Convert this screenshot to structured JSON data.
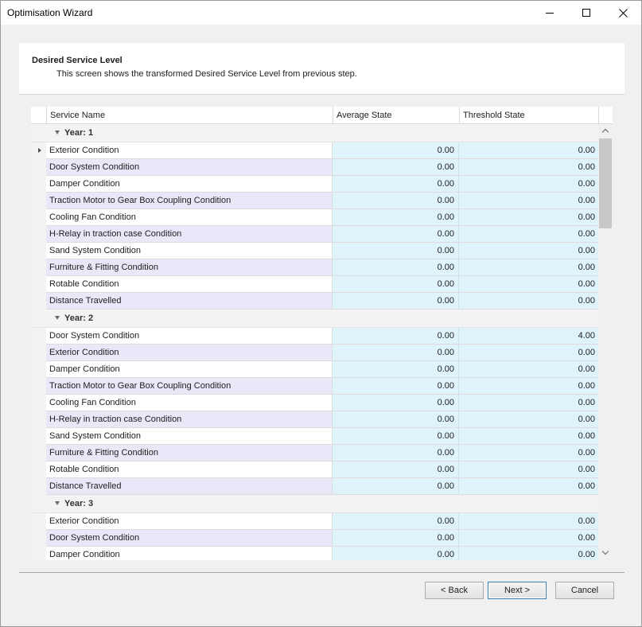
{
  "window": {
    "title": "Optimisation Wizard"
  },
  "header": {
    "title": "Desired Service Level",
    "subtitle": "This screen shows the transformed Desired Service Level from previous step."
  },
  "grid": {
    "columns": {
      "name": "Service Name",
      "average": "Average State",
      "threshold": "Threshold State"
    },
    "groups": [
      {
        "label": "Year: 1",
        "rows": [
          {
            "name": "Exterior Condition",
            "avg": "0.00",
            "thr": "0.00"
          },
          {
            "name": "Door System Condition",
            "avg": "0.00",
            "thr": "0.00"
          },
          {
            "name": "Damper Condition",
            "avg": "0.00",
            "thr": "0.00"
          },
          {
            "name": "Traction Motor to Gear Box Coupling Condition",
            "avg": "0.00",
            "thr": "0.00"
          },
          {
            "name": "Cooling Fan Condition",
            "avg": "0.00",
            "thr": "0.00"
          },
          {
            "name": "H-Relay in traction case Condition",
            "avg": "0.00",
            "thr": "0.00"
          },
          {
            "name": "Sand System Condition",
            "avg": "0.00",
            "thr": "0.00"
          },
          {
            "name": "Furniture & Fitting Condition",
            "avg": "0.00",
            "thr": "0.00"
          },
          {
            "name": "Rotable Condition",
            "avg": "0.00",
            "thr": "0.00"
          },
          {
            "name": "Distance Travelled",
            "avg": "0.00",
            "thr": "0.00"
          }
        ]
      },
      {
        "label": "Year: 2",
        "rows": [
          {
            "name": "Door System Condition",
            "avg": "0.00",
            "thr": "4.00"
          },
          {
            "name": "Exterior Condition",
            "avg": "0.00",
            "thr": "0.00"
          },
          {
            "name": "Damper Condition",
            "avg": "0.00",
            "thr": "0.00"
          },
          {
            "name": "Traction Motor to Gear Box Coupling Condition",
            "avg": "0.00",
            "thr": "0.00"
          },
          {
            "name": "Cooling Fan Condition",
            "avg": "0.00",
            "thr": "0.00"
          },
          {
            "name": "H-Relay in traction case Condition",
            "avg": "0.00",
            "thr": "0.00"
          },
          {
            "name": "Sand System Condition",
            "avg": "0.00",
            "thr": "0.00"
          },
          {
            "name": "Furniture & Fitting Condition",
            "avg": "0.00",
            "thr": "0.00"
          },
          {
            "name": "Rotable Condition",
            "avg": "0.00",
            "thr": "0.00"
          },
          {
            "name": "Distance Travelled",
            "avg": "0.00",
            "thr": "0.00"
          }
        ]
      },
      {
        "label": "Year: 3",
        "rows": [
          {
            "name": "Exterior Condition",
            "avg": "0.00",
            "thr": "0.00"
          },
          {
            "name": "Door System Condition",
            "avg": "0.00",
            "thr": "0.00"
          },
          {
            "name": "Damper Condition",
            "avg": "0.00",
            "thr": "0.00"
          }
        ]
      }
    ]
  },
  "buttons": {
    "back": "< Back",
    "next": "Next >",
    "cancel": "Cancel"
  },
  "icons": {
    "minimize": "minimize-icon",
    "maximize": "maximize-icon",
    "close": "close-icon",
    "row-indicator": "row-indicator-arrow-icon",
    "group-expand": "group-collapse-triangle-icon"
  }
}
